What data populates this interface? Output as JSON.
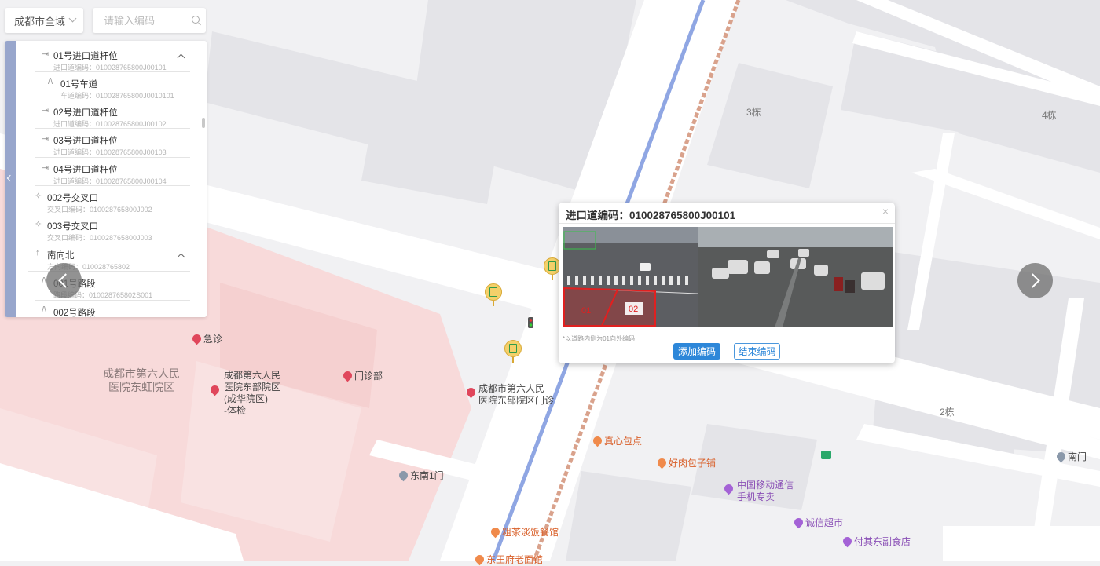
{
  "controls": {
    "city_select": "成都市全域",
    "search_placeholder": "请输入编码"
  },
  "tree": {
    "items": [
      {
        "name": "01号进口道杆位",
        "code": "进口道编码：010028765800J00101",
        "icon": "entrance-icon"
      },
      {
        "name": "01号车道",
        "code": "车道编码：010028765800J0010101",
        "icon": "lane-icon"
      },
      {
        "name": "02号进口道杆位",
        "code": "进口道编码：010028765800J00102",
        "icon": "entrance-icon"
      },
      {
        "name": "03号进口道杆位",
        "code": "进口道编码：010028765800J00103",
        "icon": "entrance-icon"
      },
      {
        "name": "04号进口道杆位",
        "code": "进口道编码：010028765800J00104",
        "icon": "entrance-icon"
      },
      {
        "name": "002号交叉口",
        "code": "交叉口编码：010028765800J002",
        "icon": "intersection-icon"
      },
      {
        "name": "003号交叉口",
        "code": "交叉口编码：010028765800J003",
        "icon": "intersection-icon"
      },
      {
        "name": "南向北",
        "code": "方向编码：010028765802",
        "icon": "direction-arrow-icon"
      },
      {
        "name": "001号路段",
        "code": "路段编码：010028765802S001",
        "icon": "lane-icon"
      },
      {
        "name": "002号路段",
        "code": "",
        "icon": "lane-icon"
      }
    ]
  },
  "popup": {
    "title": "进口道编码：010028765800J00101",
    "note": "*以道路内侧为01向外编码",
    "lane_labels": [
      "01",
      "02"
    ],
    "add_button": "添加编码",
    "end_button": "结束编码",
    "close": "×"
  },
  "map": {
    "buildings": [
      "3栋",
      "4栋",
      "2栋"
    ],
    "areas": [
      "成都市第六人民医院东虹院区"
    ],
    "pois": {
      "jizhen": "急诊",
      "hospital_east_1": "成都第六人民",
      "hospital_east_2": "医院东部院区",
      "hospital_east_3": "(成华院区)",
      "hospital_east_4": "-体检",
      "menzhenbu": "门诊部",
      "clinic_1": "成都市第六人民",
      "clinic_2": "医院东部院区门诊",
      "zhenxin": "真心包点",
      "baozi": "好肉包子铺",
      "mobile_1": "中国移动通信",
      "mobile_2": "手机专卖",
      "chengxin": "诚信超市",
      "fuqi": "付其东副食店",
      "dongnan_gate": "东南1门",
      "south_gate": "南门",
      "tea": "粗茶淡饭餐馆",
      "bottom_cut": "东王府老面馆"
    }
  },
  "colors": {
    "accent": "#2d87d9",
    "panel_bar": "#98a6cc",
    "hospital_area": "#f6dede",
    "lane_box": "#e02020"
  }
}
